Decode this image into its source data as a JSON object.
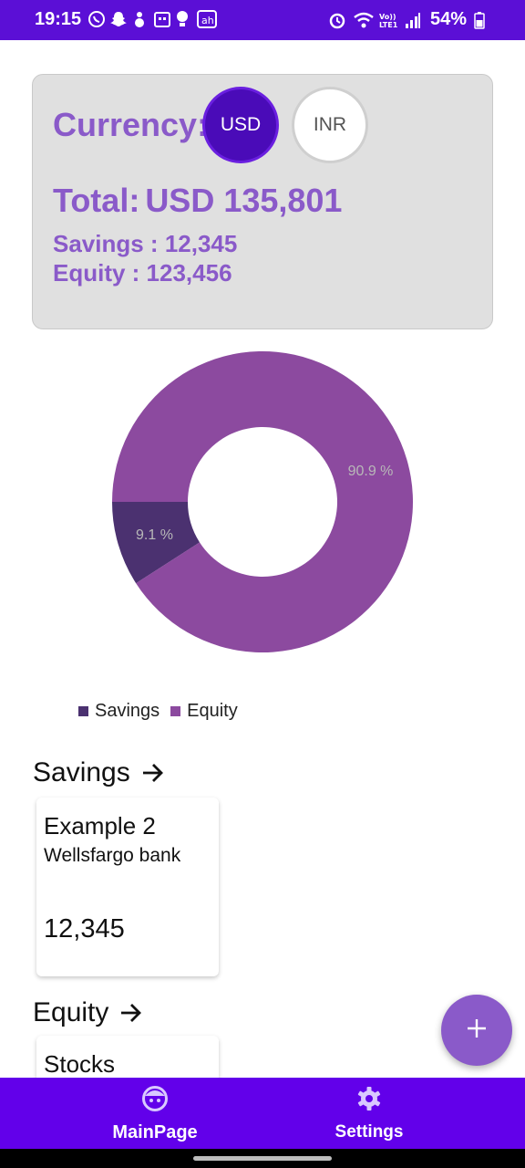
{
  "status_bar": {
    "time": "19:15",
    "battery": "54%",
    "notification_icons": [
      "whatsapp-icon",
      "snapchat-icon",
      "notification-icon",
      "calendar-icon",
      "bulb-icon",
      "app-icon"
    ],
    "system_icons": [
      "alarm-icon",
      "wifi-icon",
      "volte-icon",
      "signal-icon",
      "battery-icon"
    ]
  },
  "summary": {
    "currency_label": "Currency:",
    "currency_options": [
      "USD",
      "INR"
    ],
    "selected_currency": "USD",
    "total_label": "Total:",
    "total_value": "USD 135,801",
    "savings_line": "Savings : 12,345",
    "equity_line": "Equity : 123,456"
  },
  "chart_data": {
    "type": "pie",
    "donut": true,
    "labels": [
      "Savings",
      "Equity"
    ],
    "values": [
      12345,
      123456
    ],
    "percent_labels": [
      "9.1 %",
      "90.9 %"
    ],
    "colors": [
      "#4b3170",
      "#8c4a9f"
    ],
    "legend": "bottom-left"
  },
  "sections": {
    "savings_title": "Savings",
    "equity_title": "Equity",
    "savings_cards": [
      {
        "name": "Example 2",
        "bank": "Wellsfargo bank",
        "value": "12,345"
      }
    ],
    "equity_cards": [
      {
        "name": "Stocks"
      }
    ]
  },
  "fab": {
    "icon": "plus-icon"
  },
  "bottom_nav": {
    "items": [
      {
        "label": "MainPage",
        "icon": "face-icon"
      },
      {
        "label": "Settings",
        "icon": "gear-icon"
      }
    ]
  },
  "colors": {
    "primary": "#6200ea",
    "accent": "#8a5ac9"
  }
}
